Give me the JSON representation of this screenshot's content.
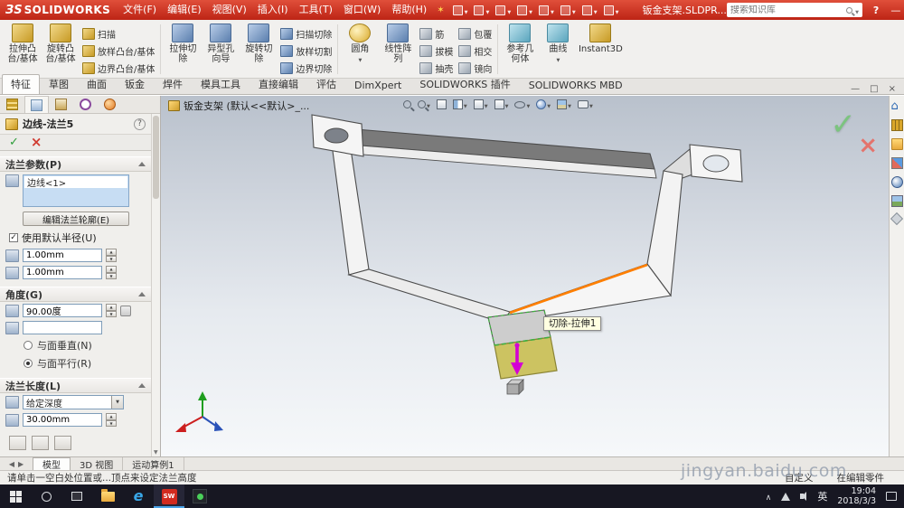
{
  "app": {
    "logo_mark": "ЗS",
    "logo_name": "SOLIDWORKS",
    "doc_title": "钣金支架.SLDPR...",
    "search_placeholder": "搜索知识库",
    "help": "?"
  },
  "menus": [
    "文件(F)",
    "编辑(E)",
    "视图(V)",
    "插入(I)",
    "工具(T)",
    "窗口(W)",
    "帮助(H)"
  ],
  "ribbon": {
    "boss_extrude": {
      "l1": "拉伸凸",
      "l2": "台/基体"
    },
    "revolve": {
      "l1": "旋转凸",
      "l2": "台/基体"
    },
    "stack1": [
      "扫描",
      "放样凸台/基体",
      "边界凸台/基体"
    ],
    "cut_extrude": {
      "l1": "拉伸切",
      "l2": "除"
    },
    "hole_wizard": {
      "l1": "异型孔",
      "l2": "向导"
    },
    "cut_revolve": {
      "l1": "旋转切",
      "l2": "除"
    },
    "stack2": [
      "扫描切除",
      "放样切割",
      "边界切除"
    ],
    "fillet": {
      "l1": "圆角",
      "l2": ""
    },
    "pattern": {
      "l1": "线性阵",
      "l2": "列"
    },
    "stack3": [
      "筋",
      "拔模",
      "抽壳"
    ],
    "stack4": [
      "包覆",
      "相交",
      "镜向"
    ],
    "ref_geo": {
      "l1": "参考几",
      "l2": "何体"
    },
    "curves": {
      "l1": "曲线",
      "l2": ""
    },
    "instant3d": {
      "l1": "Instant3D",
      "l2": ""
    }
  },
  "command_tabs": [
    "特征",
    "草图",
    "曲面",
    "钣金",
    "焊件",
    "模具工具",
    "直接编辑",
    "评估",
    "DimXpert",
    "SOLIDWORKS 插件",
    "SOLIDWORKS MBD"
  ],
  "panel": {
    "title": "边线-法兰5",
    "help": "?",
    "params_header": "法兰参数(P)",
    "selection_item": "边线<1>",
    "edit_profile": "编辑法兰轮廓(E)",
    "use_default_radius": "使用默认半径(U)",
    "radius": "1.00mm",
    "gauge": "1.00mm",
    "angle_header": "角度(G)",
    "angle_value": "90.00度",
    "radio_perpendicular": "与面垂直(N)",
    "radio_parallel": "与面平行(R)",
    "length_header": "法兰长度(L)",
    "end_condition": "给定深度",
    "length_value": "30.00mm"
  },
  "viewport": {
    "doc_tab": "钣金支架 (默认<<默认>_...",
    "tooltip": "切除-拉伸1",
    "watermark": "jingyan.baidu.com"
  },
  "model_tabs": [
    "模型",
    "3D 视图",
    "运动算例1"
  ],
  "status": {
    "message": "请单击一空白处位置或...顶点来设定法兰高度",
    "custom": "自定义",
    "mode": "在编辑零件"
  },
  "taskbar": {
    "time": "19:04",
    "date": "2018/3/3",
    "lang": "英"
  },
  "colors": {
    "titlebar_red": "#cf3123",
    "highlight_edge_orange": "#ff7f00",
    "flange_preview_yellow": "#c9bf55",
    "direction_arrow_magenta": "#d400d4",
    "selection_box_blue": "#c7ddf3",
    "confirm_green": "#7cc47f",
    "cancel_red": "#e4736c",
    "taskbar_dark": "#171722"
  },
  "icon_names": {
    "qat": [
      "new-file",
      "open",
      "save",
      "print",
      "undo",
      "select",
      "rebuild",
      "options"
    ],
    "hud": [
      "zoom-fit",
      "zoom-area",
      "previous-view",
      "section-view",
      "view-orientation",
      "display-style",
      "hide-show-items",
      "edit-appearance",
      "apply-scene",
      "view-settings",
      "camera"
    ],
    "panel_tabs": [
      "featuremanager-tree",
      "propertymanager",
      "configurationmanager",
      "dimxpertmanager",
      "displaymanager"
    ],
    "task_pane": [
      "home",
      "design-library",
      "file-explorer",
      "view-palette",
      "appearances",
      "custom-properties",
      "tag"
    ],
    "taskbar": [
      "start",
      "search",
      "task-view",
      "file-explorer",
      "edge",
      "solidworks",
      "utility-app"
    ]
  }
}
